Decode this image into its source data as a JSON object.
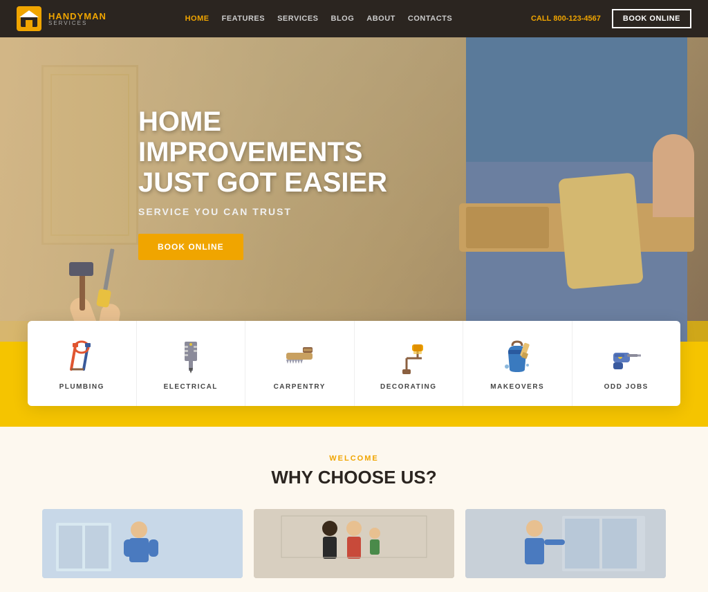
{
  "header": {
    "logo": {
      "handyman": "HANDY",
      "handyman_highlight": "MAN",
      "services": "SERVICES"
    },
    "nav": [
      {
        "label": "HOME",
        "active": true
      },
      {
        "label": "FEATURES",
        "active": false
      },
      {
        "label": "SERVICES",
        "active": false
      },
      {
        "label": "BLOG",
        "active": false
      },
      {
        "label": "ABOUT",
        "active": false
      },
      {
        "label": "CONTACTS",
        "active": false
      }
    ],
    "call_label": "CALL",
    "call_number": "800-123-4567",
    "book_online": "BOOK ONLINE"
  },
  "hero": {
    "title_line1": "HOME IMPROVEMENTS",
    "title_line2": "JUST GOT EASIER",
    "subtitle": "SERVICE YOU CAN TRUST",
    "cta": "BOOK ONLINE"
  },
  "services": [
    {
      "id": "plumbing",
      "label": "PLUMBING"
    },
    {
      "id": "electrical",
      "label": "ELECTRICAL"
    },
    {
      "id": "carpentry",
      "label": "CARPENTRY"
    },
    {
      "id": "decorating",
      "label": "DECORATING"
    },
    {
      "id": "makeovers",
      "label": "MAKEOVERS"
    },
    {
      "id": "odd-jobs",
      "label": "ODD JOBS"
    }
  ],
  "why_section": {
    "welcome": "WELCOME",
    "title": "WHY CHOOSE US?"
  }
}
